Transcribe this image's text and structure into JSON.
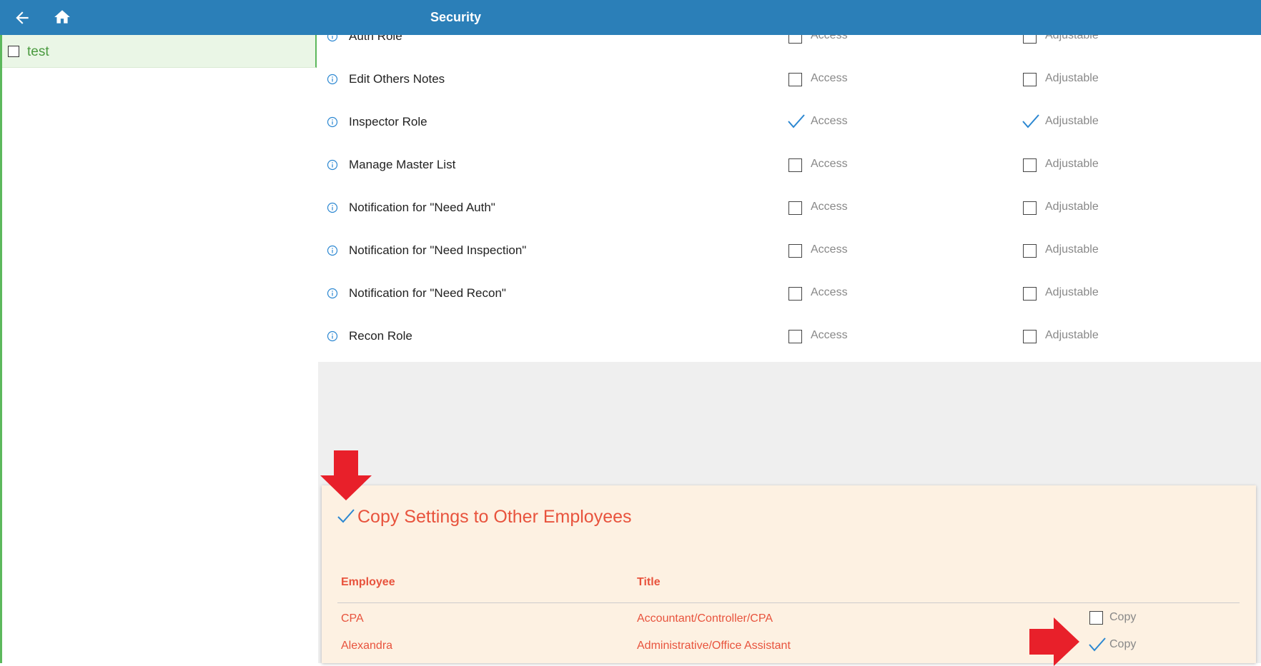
{
  "header": {
    "title": "Security"
  },
  "sidebar": {
    "items": [
      {
        "label": "test",
        "checked": false
      }
    ]
  },
  "roles": [
    {
      "name": "Auth Role",
      "access_label": "Access",
      "access": false,
      "adjustable_label": "Adjustable",
      "adjustable": false
    },
    {
      "name": "Edit Others Notes",
      "access_label": "Access",
      "access": false,
      "adjustable_label": "Adjustable",
      "adjustable": false
    },
    {
      "name": "Inspector Role",
      "access_label": "Access",
      "access": true,
      "adjustable_label": "Adjustable",
      "adjustable": true
    },
    {
      "name": "Manage Master List",
      "access_label": "Access",
      "access": false,
      "adjustable_label": "Adjustable",
      "adjustable": false
    },
    {
      "name": "Notification for \"Need Auth\"",
      "access_label": "Access",
      "access": false,
      "adjustable_label": "Adjustable",
      "adjustable": false
    },
    {
      "name": "Notification for \"Need Inspection\"",
      "access_label": "Access",
      "access": false,
      "adjustable_label": "Adjustable",
      "adjustable": false
    },
    {
      "name": "Notification for \"Need Recon\"",
      "access_label": "Access",
      "access": false,
      "adjustable_label": "Adjustable",
      "adjustable": false
    },
    {
      "name": "Recon Role",
      "access_label": "Access",
      "access": false,
      "adjustable_label": "Adjustable",
      "adjustable": false
    }
  ],
  "copy_settings": {
    "title": "Copy Settings to Other Employees",
    "checked": true,
    "columns": {
      "employee": "Employee",
      "title": "Title"
    },
    "rows": [
      {
        "employee": "CPA",
        "title": "Accountant/Controller/CPA",
        "copy_label": "Copy",
        "copy": false
      },
      {
        "employee": "Alexandra",
        "title": "Administrative/Office Assistant",
        "copy_label": "Copy",
        "copy": true
      }
    ]
  },
  "colors": {
    "header": "#2b7fb8",
    "accent": "#e8533d",
    "check": "#2b87d1",
    "arrow": "#e8202a",
    "sidebar_accent": "#5cb85c"
  },
  "icons": {
    "back": "arrow-left-icon",
    "home": "home-icon",
    "info": "info-circle-icon",
    "check": "checkmark-icon",
    "pointer": "red-arrow-icon"
  }
}
